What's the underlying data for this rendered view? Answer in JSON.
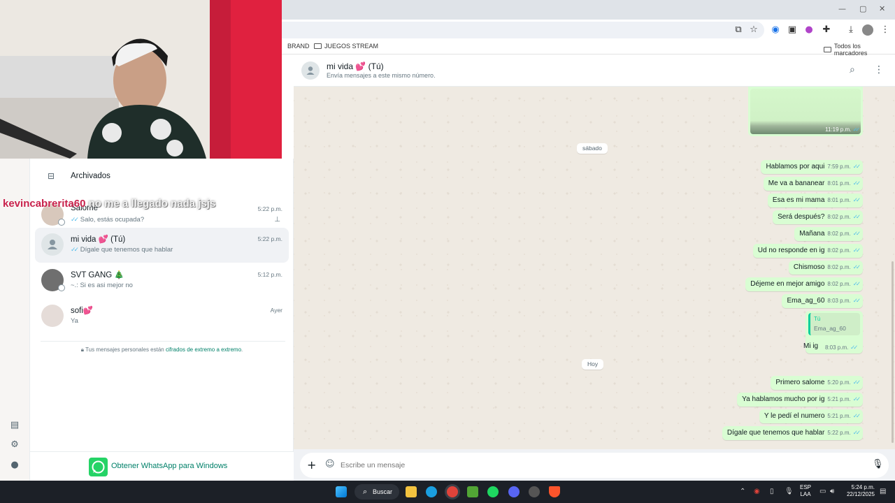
{
  "browser": {
    "bookmarks": {
      "brand": "BRAND",
      "juegos": "JUEGOS STREAM",
      "todos": "Todos los marcadores"
    },
    "window_controls": {
      "minimize": "—",
      "maximize": "▢",
      "close": "✕"
    }
  },
  "stream_overlay": {
    "nick": "kevincabrerita60",
    "text": " no me a llegado nada jsjs"
  },
  "sidebar": {
    "archived_label": "Archivados",
    "chats": [
      {
        "name": "Salomé",
        "preview": "Salo, estás ocupada?",
        "time": "5:22 p.m.",
        "pinned": true
      },
      {
        "name": "mi vida 💕 (Tú)",
        "preview": "Dígale que tenemos que hablar",
        "time": "5:22 p.m."
      },
      {
        "name": "SVT GANG 🎄",
        "preview": "~.: Si es asi mejor no",
        "time": "5:12 p.m."
      },
      {
        "name": "sofi💕",
        "preview": "Ya",
        "time": "Ayer"
      }
    ],
    "encryption_text": "Tus mensajes personales están ",
    "encryption_link": "cifrados de extremo a extremo",
    "encryption_end": ".",
    "get_app_label": "Obtener WhatsApp para Windows"
  },
  "chat_header": {
    "title": "mi vida 💕 (Tú)",
    "subtitle": "Envía mensajes a este mismo número."
  },
  "conversation": {
    "image_time": "11:19 p.m.",
    "divider_1": "sábado",
    "divider_2": "Hoy",
    "messages_saturday": [
      {
        "text": "Hablamos por aqui",
        "time": "7:59 p.m."
      },
      {
        "text": "Me va a bananear",
        "time": "8:01 p.m."
      },
      {
        "text": "Esa es mi mama",
        "time": "8:01 p.m."
      },
      {
        "text": "Será después?",
        "time": "8:02 p.m."
      },
      {
        "text": "Mañana",
        "time": "8:02 p.m."
      },
      {
        "text": "Ud no responde en ig",
        "time": "8:02 p.m."
      },
      {
        "text": "Chismoso",
        "time": "8:02 p.m."
      },
      {
        "text": "Déjeme en mejor amigo",
        "time": "8:02 p.m."
      },
      {
        "text": "Ema_ag_60",
        "time": "8:03 p.m."
      }
    ],
    "reply": {
      "quote_author": "Tú",
      "quote_text": "Ema_ag_60",
      "text": "Mi ig",
      "time": "8:03 p.m."
    },
    "messages_today": [
      {
        "text": "Primero salome",
        "time": "5:20 p.m."
      },
      {
        "text": "Ya hablamos mucho por ig",
        "time": "5:21 p.m."
      },
      {
        "text": "Y le pedí el numero",
        "time": "5:21 p.m."
      },
      {
        "text": "Dígale que tenemos que hablar",
        "time": "5:22 p.m."
      }
    ]
  },
  "composer": {
    "placeholder": "Escribe un mensaje"
  },
  "taskbar": {
    "search_label": "Buscar",
    "lang": "ESP",
    "layout": "LAA",
    "time": "5:24 p.m.",
    "date": "22/12/2025"
  },
  "colors": {
    "whatsapp_green": "#25d366",
    "outgoing_bubble": "#d9fdd3",
    "chat_bg": "#efeae2",
    "ticks": "#53bdeb"
  }
}
